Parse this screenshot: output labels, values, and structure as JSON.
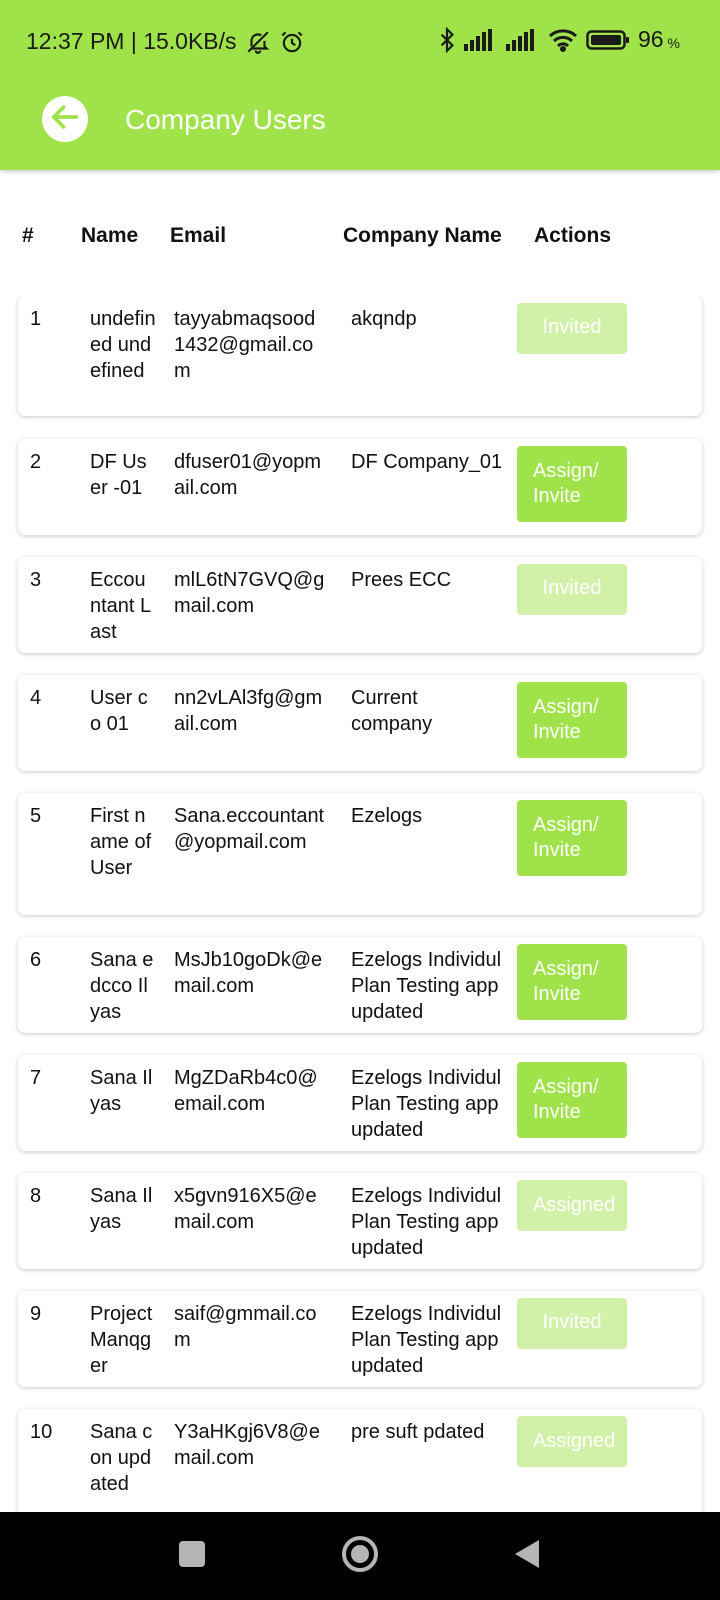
{
  "status_bar": {
    "time_speed": "12:37 PM | 15.0KB/s",
    "battery_pct": "96",
    "battery_unit": "%"
  },
  "app_bar": {
    "title": "Company Users"
  },
  "table": {
    "headers": {
      "num": "#",
      "name": "Name",
      "email": "Email",
      "company": "Company Name",
      "actions": "Actions"
    },
    "rows": [
      {
        "num": "1",
        "name": "undefined undefined",
        "email": "tayyabmaqsood1432@gmail.com",
        "company": [
          "akqndp"
        ],
        "action": "Invited",
        "action_state": "faded"
      },
      {
        "num": "2",
        "name": "DF User -01",
        "email": "dfuser01@yopmail.com",
        "company": [
          "DF Company_01"
        ],
        "action": "Assign/ Invite",
        "action_state": "active"
      },
      {
        "num": "3",
        "name": "Eccountant Last",
        "email": "mlL6tN7GVQ@gmail.com",
        "company": [
          "Prees ECC"
        ],
        "action": "Invited",
        "action_state": "faded"
      },
      {
        "num": "4",
        "name": "User co 01",
        "email": "nn2vLAl3fg@gmail.com",
        "company": [
          "Current",
          "company"
        ],
        "action": "Assign/ Invite",
        "action_state": "active"
      },
      {
        "num": "5",
        "name": "First name of User",
        "email": "Sana.eccountant@yopmail.com",
        "company": [
          "Ezelogs"
        ],
        "action": "Assign/ Invite",
        "action_state": "active"
      },
      {
        "num": "6",
        "name": "Sana edcco Ilyas",
        "email": "MsJb10goDk@email.com",
        "company": [
          "Ezelogs Individul",
          "Plan Testing app",
          "updated"
        ],
        "action": "Assign/ Invite",
        "action_state": "active"
      },
      {
        "num": "7",
        "name": "Sana Ilyas",
        "email": "MgZDaRb4c0@email.com",
        "company": [
          "Ezelogs Individul",
          "Plan Testing app",
          "updated"
        ],
        "action": "Assign/ Invite",
        "action_state": "active"
      },
      {
        "num": "8",
        "name": "Sana Ilyas",
        "email": "x5gvn916X5@email.com",
        "company": [
          "Ezelogs Individul",
          "Plan Testing app",
          "updated"
        ],
        "action": "Assigned",
        "action_state": "faded"
      },
      {
        "num": "9",
        "name": "Project Manqger",
        "email": "saif@gmmail.com",
        "company": [
          "Ezelogs Individul",
          "Plan Testing app",
          "updated"
        ],
        "action": "Invited",
        "action_state": "faded"
      },
      {
        "num": "10",
        "name": "Sana con updated",
        "email": "Y3aHKgj6V8@email.com",
        "company": [
          "pre suft pdated"
        ],
        "action": "Assigned",
        "action_state": "faded"
      }
    ]
  },
  "colors": {
    "accent": "#a0e24a",
    "accent_faded": "#d2f1a8",
    "nav_bg": "#000000"
  },
  "icons": [
    "mute-bell-icon",
    "alarm-icon",
    "bluetooth-icon",
    "signal-icon",
    "wifi-icon",
    "battery-icon",
    "back-arrow-icon",
    "recents-square-icon",
    "home-circle-icon",
    "back-triangle-icon"
  ]
}
